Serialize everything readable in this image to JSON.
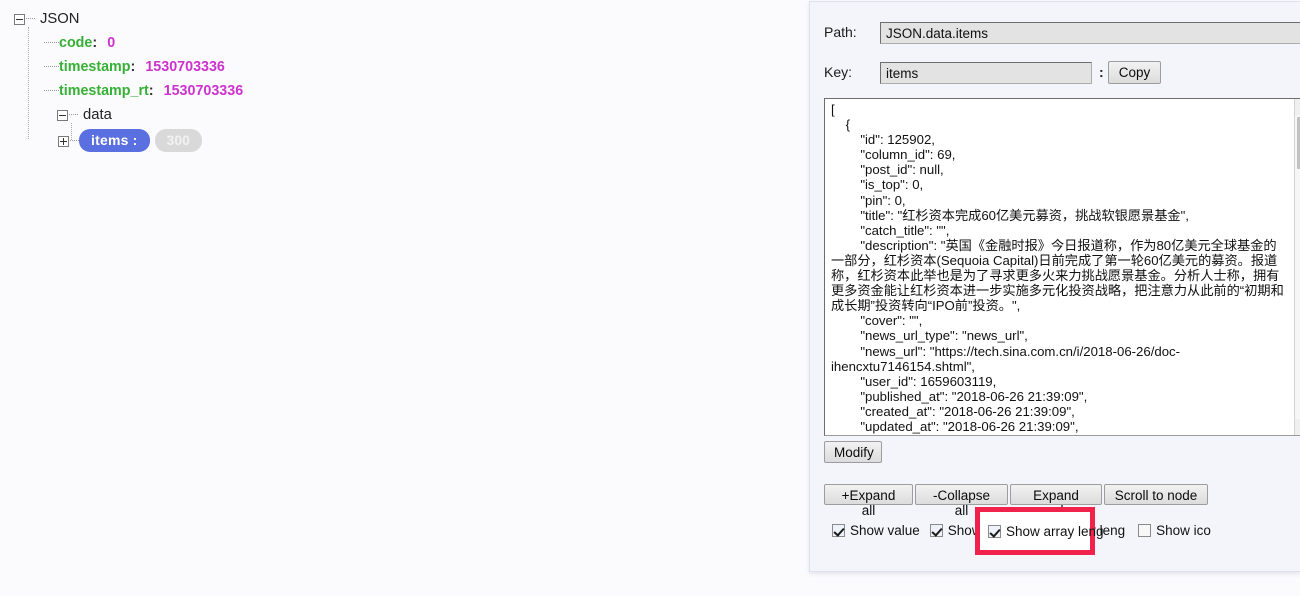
{
  "tree": {
    "root_label": "JSON",
    "nodes": [
      {
        "key": "code",
        "colon": ":",
        "value": "0"
      },
      {
        "key": "timestamp",
        "colon": ":",
        "value": "1530703336"
      },
      {
        "key": "timestamp_rt",
        "colon": ":",
        "value": "1530703336"
      }
    ],
    "data_label": "data",
    "items_label": "items :",
    "items_length": "300"
  },
  "panel": {
    "path_label": "Path:",
    "path_value": "JSON.data.items",
    "key_label": "Key:",
    "key_value": "items",
    "key_colon": ":",
    "copy_label": "Copy",
    "modify_label": "Modify",
    "json_text": "[\n    {\n        \"id\": 125902,\n        \"column_id\": 69,\n        \"post_id\": null,\n        \"is_top\": 0,\n        \"pin\": 0,\n        \"title\": \"红杉资本完成60亿美元募资，挑战软银愿景基金\",\n        \"catch_title\": \"\",\n        \"description\": \"英国《金融时报》今日报道称，作为80亿美元全球基金的一部分，红杉资本(Sequoia Capital)日前完成了第一轮60亿美元的募资。报道称，红杉资本此举也是为了寻求更多火来力挑战愿景基金。分析人士称，拥有更多资金能让红杉资本进一步实施多元化投资战略，把注意力从此前的“初期和成长期”投资转向“IPO前”投资。\",\n        \"cover\": \"\",\n        \"news_url_type\": \"news_url\",\n        \"news_url\": \"https://tech.sina.com.cn/i/2018-06-26/doc-ihencxtu7146154.shtml\",\n        \"user_id\": 1659603119,\n        \"published_at\": \"2018-06-26 21:39:09\",\n        \"created_at\": \"2018-06-26 21:39:09\",\n        \"updated_at\": \"2018-06-26 21:39:09\",",
    "buttons": [
      {
        "label": "+Expand all"
      },
      {
        "label": "-Collapse all"
      },
      {
        "label": "Expand node"
      },
      {
        "label": "Scroll to node"
      }
    ],
    "checkboxes": [
      {
        "label": "Show value",
        "checked": true
      },
      {
        "label": "Show im",
        "checked": true
      },
      {
        "label": "Show array leng",
        "checked": true
      },
      {
        "label": "Show ico",
        "checked": false
      }
    ],
    "highlight_checkbox": {
      "label": "Show array leng",
      "checked": true
    },
    "scrollbar": {
      "up_arrow": "▲",
      "down_arrow": "▼"
    }
  },
  "colors": {
    "tree_key": "#35b035",
    "tree_value": "#cc33cc",
    "pill_key_bg": "#5a6fe0",
    "pill_len_bg": "#d9d9d9",
    "highlight": "#f0224c",
    "panel_bg": "#f4f5fb",
    "page_bg": "#fbfbfe"
  }
}
